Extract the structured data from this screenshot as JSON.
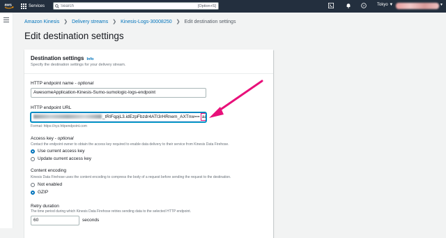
{
  "topbar": {
    "logo": "aws",
    "services_label": "Services",
    "search_placeholder": "Search",
    "search_shortcut": "[Option+S]",
    "icons": [
      "cloudshell-icon",
      "bell-icon",
      "help-icon"
    ],
    "region": "Tokyo ▼"
  },
  "breadcrumb": {
    "items": [
      "Amazon Kinesis",
      "Delivery streams",
      "Kinesis-Logs-30008250",
      "Edit destination settings"
    ]
  },
  "page": {
    "title": "Edit destination settings"
  },
  "panel": {
    "title": "Destination settings",
    "info": "Info",
    "description": "Specify the destination settings for your delivery stream.",
    "endpoint_name": {
      "label": "HTTP endpoint name",
      "optional": "optional",
      "value": "AwesomeApplication-Kinesis-Sumo-sumologic-logs-endpoint"
    },
    "endpoint_url": {
      "label": "HTTP endpoint URL",
      "value_visible": "_tRIFqpjL3.idEzpFbzdr4ATI3rHRnem_AXTnw==",
      "value_highlight": "aaa",
      "format": "Format: https://xyz.httpendpoint.com"
    },
    "access_key": {
      "label": "Access key",
      "optional": "optional",
      "description": "Contact the endpoint owner to obtain the access key required to enable data delivery to their service from Kinesis Data Firehose.",
      "options": [
        "Use current access key",
        "Update current access key"
      ],
      "selected": 0
    },
    "encoding": {
      "label": "Content encoding",
      "description": "Kinesis Data Firehose uses the content encoding to compress the body of a request before sending the request to the destination.",
      "options": [
        "Not enabled",
        "GZIP"
      ],
      "selected": 1
    },
    "retry": {
      "label": "Retry duration",
      "description": "The time period during which Kinesis Data Firehose retries sending data to the selected HTTP endpoint.",
      "value": "60",
      "unit": "seconds"
    }
  },
  "colors": {
    "accent": "#0073bb",
    "annotation": "#e8107a",
    "navbar": "#232f3e"
  }
}
